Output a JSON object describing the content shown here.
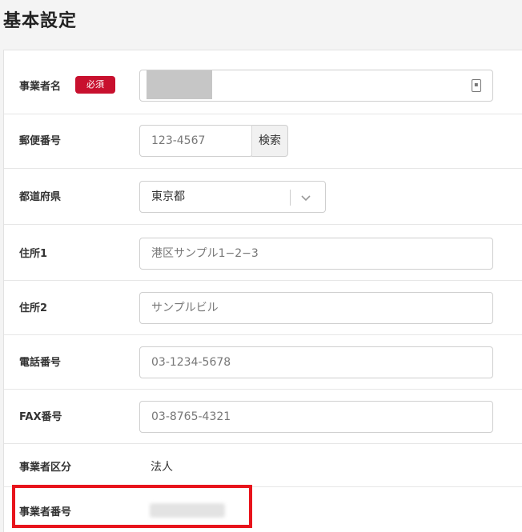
{
  "page": {
    "title": "基本設定"
  },
  "form": {
    "business_name": {
      "label": "事業者名",
      "required_badge": "必須",
      "value": ""
    },
    "postal_code": {
      "label": "郵便番号",
      "placeholder": "123-4567",
      "search_label": "検索"
    },
    "prefecture": {
      "label": "都道府県",
      "selected": "東京都"
    },
    "address1": {
      "label": "住所1",
      "placeholder": "港区サンプル1−2−3"
    },
    "address2": {
      "label": "住所2",
      "placeholder": "サンプルビル"
    },
    "phone": {
      "label": "電話番号",
      "placeholder": "03-1234-5678"
    },
    "fax": {
      "label": "FAX番号",
      "placeholder": "03-8765-4321"
    },
    "business_type": {
      "label": "事業者区分",
      "value": "法人"
    },
    "business_number": {
      "label": "事業者番号",
      "value": ""
    }
  },
  "colors": {
    "required_badge": "#c8102e",
    "highlight_border": "#e8141c"
  },
  "icons": {
    "contact_card": "contact-card-icon",
    "select_caret": "chevron-down-icon"
  }
}
